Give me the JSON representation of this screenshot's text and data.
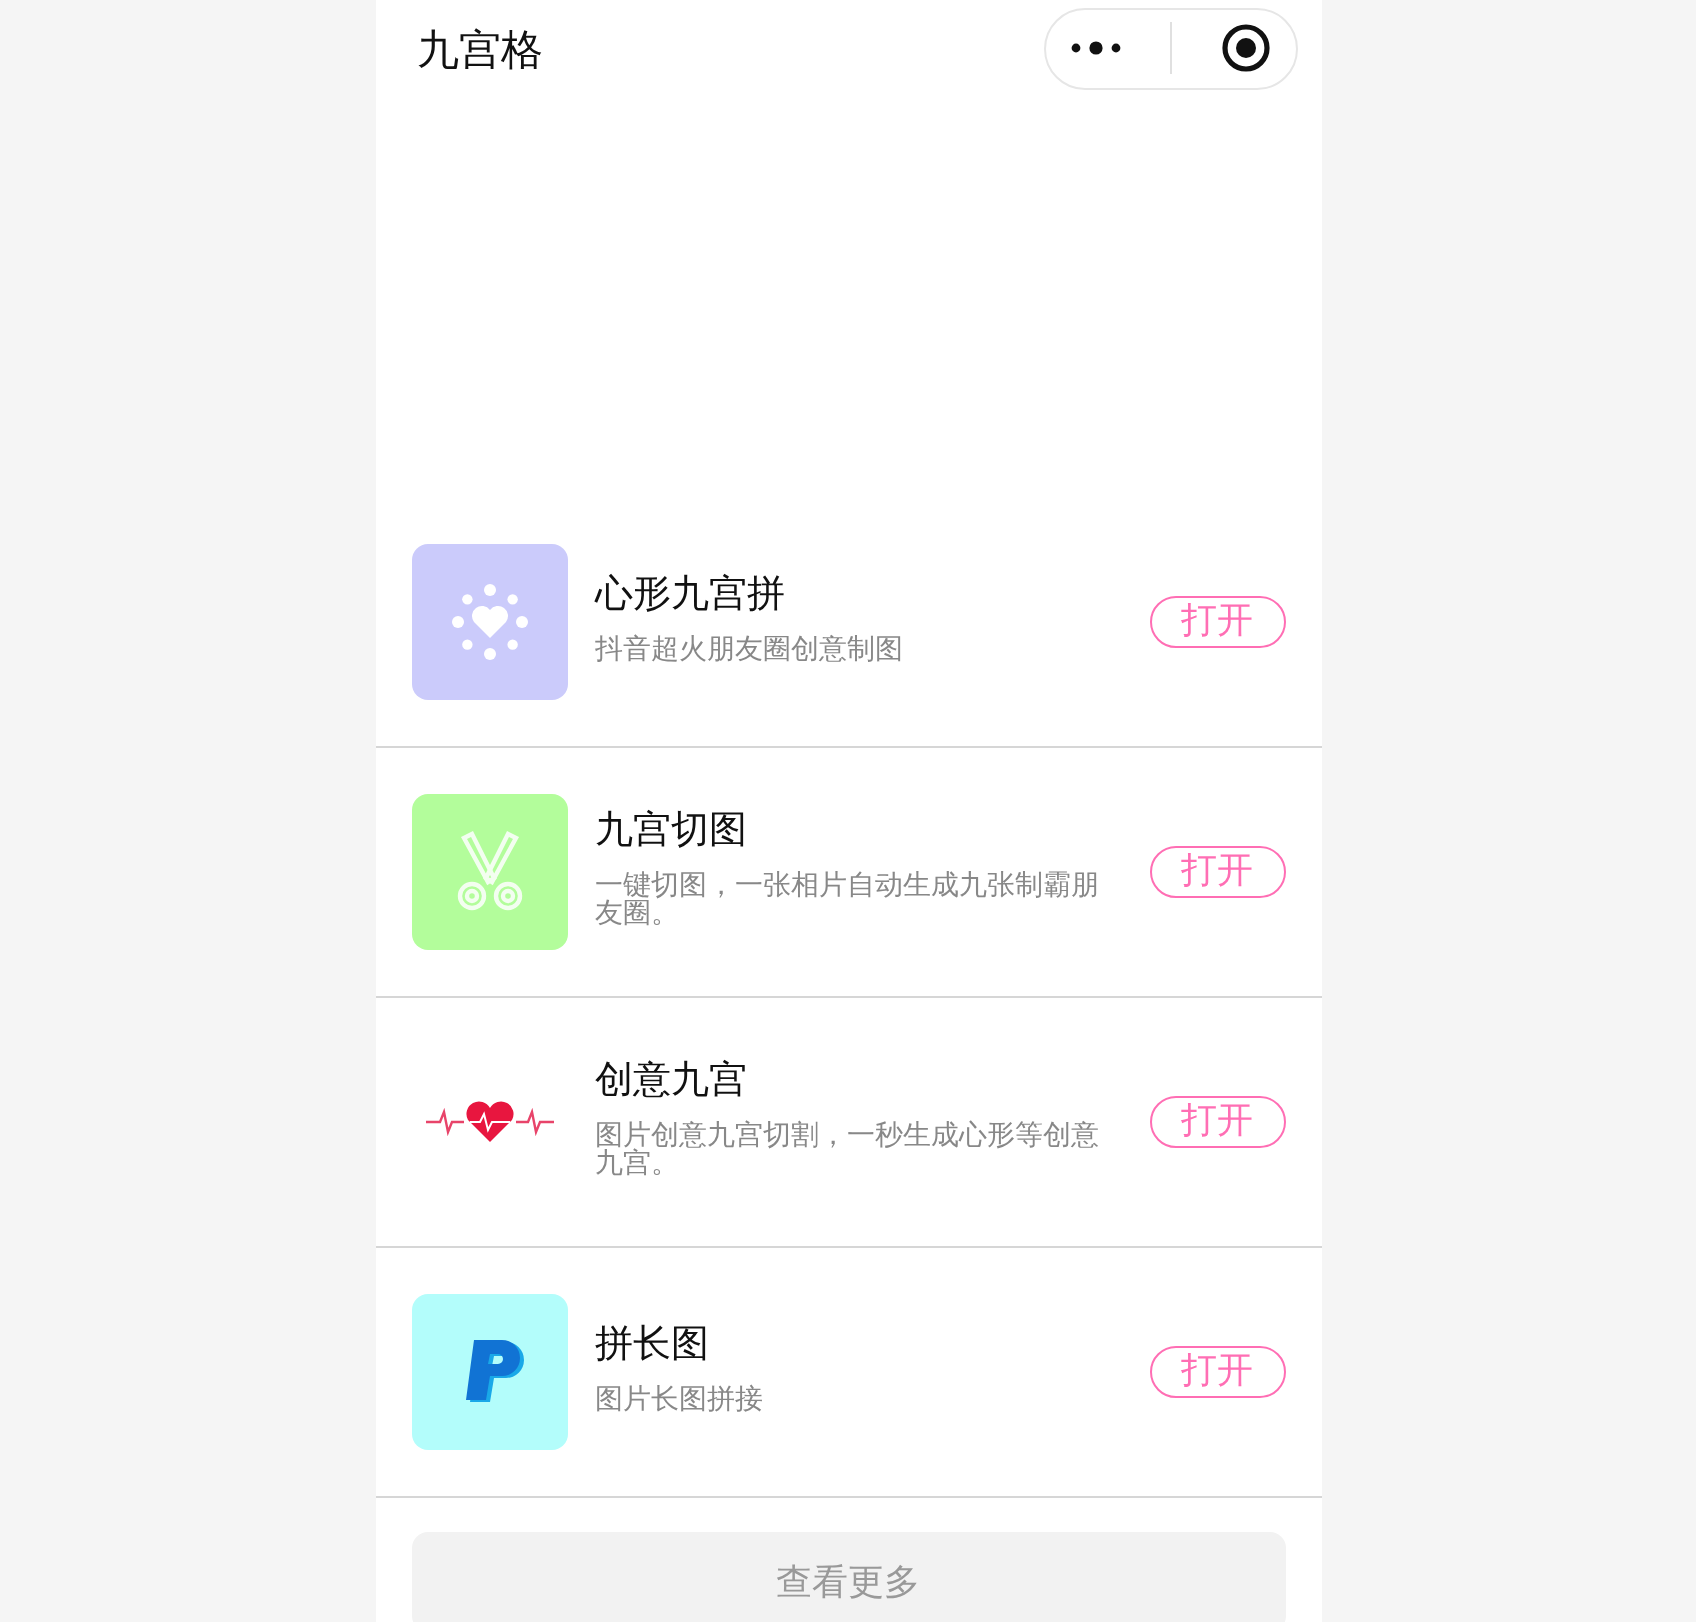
{
  "header": {
    "title": "九宫格"
  },
  "apps": [
    {
      "title": "心形九宫拼",
      "description": "抖音超火朋友圈创意制图",
      "button": "打开",
      "icon": {
        "kind": "heart-ring",
        "color": "#cbcbfb"
      }
    },
    {
      "title": "九宫切图",
      "description": "一键切图，一张相片自动生成九张制霸朋友圈。",
      "button": "打开",
      "icon": {
        "kind": "scissors",
        "color": "#b3fd9b"
      }
    },
    {
      "title": "创意九宫",
      "description": "图片创意九宫切割，一秒生成心形等创意九宫。",
      "button": "打开",
      "icon": {
        "kind": "heartbeat",
        "color": "#ffffff"
      }
    },
    {
      "title": "拼长图",
      "description": "图片长图拼接",
      "button": "打开",
      "icon": {
        "kind": "p-logo",
        "color": "#b3fdfb"
      }
    }
  ],
  "more_button": "查看更多"
}
